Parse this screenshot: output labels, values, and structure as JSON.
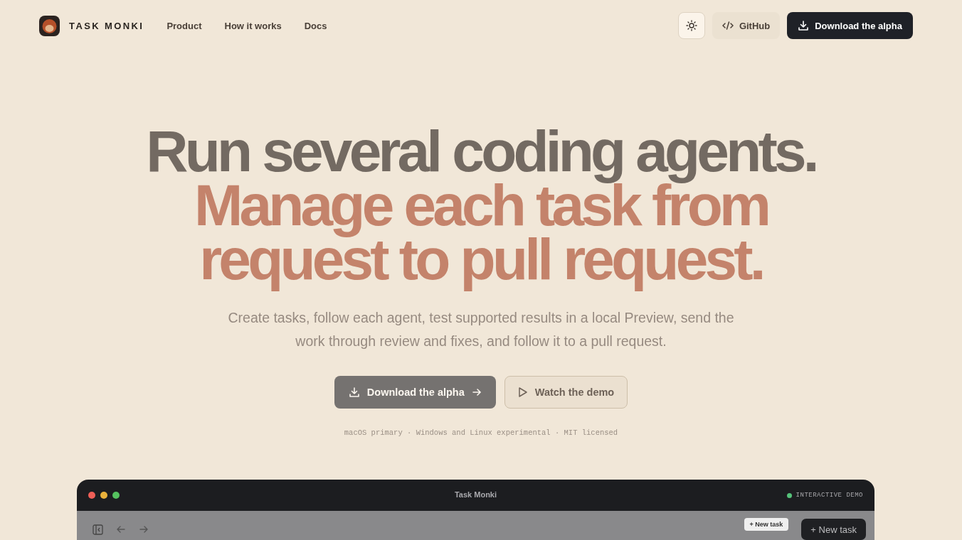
{
  "brand": {
    "name": "TASK MONKI"
  },
  "nav": {
    "links": [
      "Product",
      "How it works",
      "Docs"
    ],
    "github": "GitHub",
    "download": "Download the alpha"
  },
  "hero": {
    "lines": [
      {
        "text": "Run several coding agents.",
        "kind": "muted"
      },
      {
        "text": "Manage each task from",
        "kind": "accent"
      },
      {
        "text": "request to pull request.",
        "kind": "accent"
      }
    ],
    "subtitle": "Create tasks, follow each agent, test supported results in a local Preview, send the work through review and fixes, and follow it to a pull request.",
    "primary": "Download the alpha",
    "secondary": "Watch the demo",
    "footnote": "macOS primary · Windows and Linux experimental · MIT licensed"
  },
  "demo": {
    "title": "Task Monki",
    "badge": "INTERACTIVE DEMO",
    "new_task": "+ New task",
    "ghost_new_task": "+ New task"
  }
}
